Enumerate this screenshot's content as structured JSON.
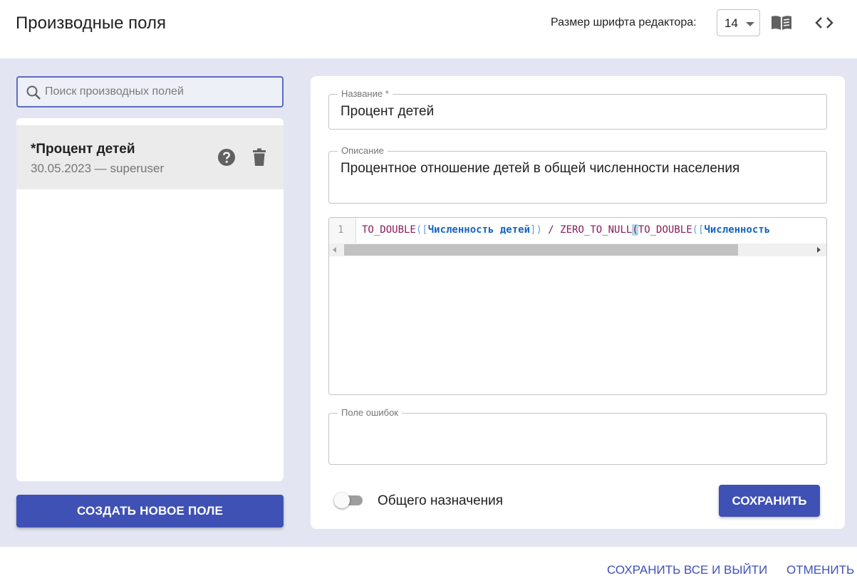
{
  "header": {
    "title": "Производные поля",
    "font_size_label": "Размер шрифта редактора:",
    "font_size_value": "14"
  },
  "search": {
    "placeholder": "Поиск производных полей"
  },
  "list": {
    "items": [
      {
        "title": "*Процент детей",
        "subtitle": "30.05.2023 — superuser"
      }
    ]
  },
  "create_button": "СОЗДАТЬ НОВОЕ ПОЛЕ",
  "form": {
    "name_label": "Название *",
    "name_value": "Процент детей",
    "description_label": "Описание",
    "description_value": "Процентное отношение детей в общей численности населения",
    "editor": {
      "line_number": "1",
      "fn1": "TO_DOUBLE",
      "br1": "([",
      "id1": "Численность детей",
      "br2": "])",
      "op1": " / ",
      "fn2": "ZERO_TO_NULL",
      "hl": "(",
      "fn3": "TO_DOUBLE",
      "br3": "([",
      "id2": "Численность"
    },
    "error_label": "Поле ошибок",
    "general_purpose_label": "Общего назначения",
    "general_purpose_on": false,
    "save_button": "СОХРАНИТЬ"
  },
  "footer": {
    "save_all": "СОХРАНИТЬ ВСЕ И ВЫЙТИ",
    "cancel": "ОТМЕНИТЬ"
  },
  "colors": {
    "primary": "#3f51b5",
    "background": "#e3e6f2"
  }
}
